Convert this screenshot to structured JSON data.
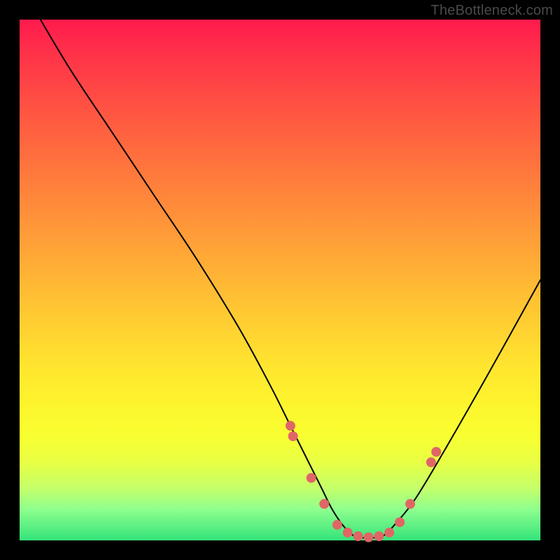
{
  "attribution": "TheBottleneck.com",
  "colors": {
    "gradient_top": "#ff1a4d",
    "gradient_mid": "#ffe42f",
    "gradient_bottom": "#34e37a",
    "curve": "#000000",
    "dots": "#e06666",
    "frame": "#000000"
  },
  "chart_data": {
    "type": "line",
    "title": "",
    "xlabel": "",
    "ylabel": "",
    "xlim": [
      0,
      100
    ],
    "ylim": [
      0,
      100
    ],
    "grid": false,
    "legend": false,
    "series": [
      {
        "name": "bottleneck-curve",
        "x": [
          4,
          10,
          18,
          26,
          34,
          42,
          48,
          52,
          56,
          58,
          60,
          62,
          64,
          66,
          68,
          70,
          72,
          76,
          82,
          90,
          100
        ],
        "values": [
          100,
          90,
          78,
          66,
          54,
          41,
          30,
          22,
          14,
          10,
          6,
          3,
          1,
          0.5,
          0.5,
          1,
          3,
          8,
          18,
          32,
          50
        ]
      }
    ],
    "markers": {
      "name": "highlight-dots",
      "x": [
        52,
        52.5,
        56,
        58.5,
        61,
        63,
        65,
        67,
        69,
        71,
        73,
        75,
        79,
        80
      ],
      "values": [
        22,
        20,
        12,
        7,
        3,
        1.5,
        0.8,
        0.6,
        0.8,
        1.5,
        3.5,
        7,
        15,
        17
      ]
    }
  }
}
